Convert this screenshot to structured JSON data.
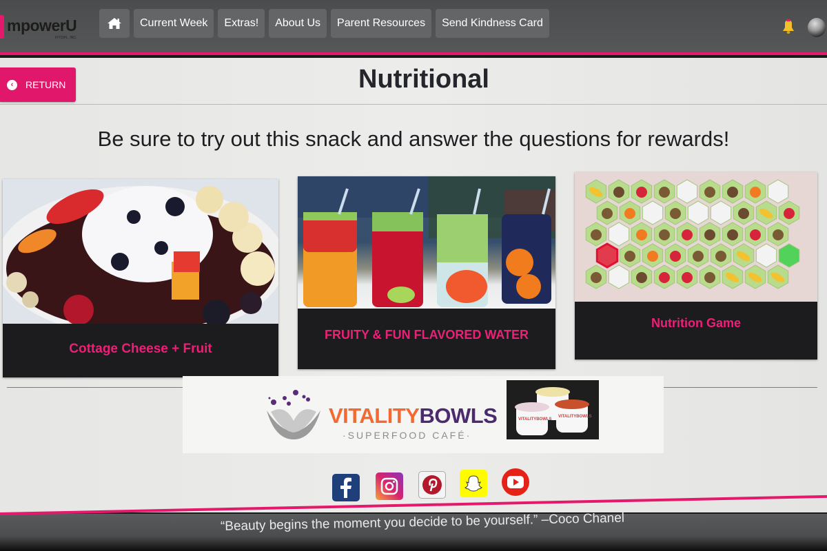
{
  "brand": {
    "logo_text": "mpowerU",
    "logo_subtext": "FITCIPL, INC."
  },
  "nav": {
    "home_icon": "home-icon",
    "items": [
      {
        "label": "Current Week"
      },
      {
        "label": "Extras!"
      },
      {
        "label": "About Us"
      },
      {
        "label": "Parent Resources"
      },
      {
        "label": "Send Kindness Card"
      }
    ]
  },
  "header_icons": {
    "notifications": "bell-icon",
    "profile": "avatar"
  },
  "page": {
    "return_label": "RETURN",
    "title": "Nutritional",
    "subtitle": "Be sure to try out this snack and answer the questions for rewards!"
  },
  "cards": [
    {
      "label": "Cottage Cheese + Fruit",
      "image": "cottage cheese with fruit, nuts and berries"
    },
    {
      "label": "FRUITY & FUN FLAVORED WATER",
      "image": "four mason jars of fruit-infused water"
    },
    {
      "label": "Nutrition Game",
      "image": "hexagon fruit-matching game board"
    }
  ],
  "ad": {
    "brand_part1": "VITALITY",
    "brand_part2": "BOWLS",
    "tagline": "·SUPERFOOD CAFÉ·",
    "cup_label": "VITALITYBOWLS"
  },
  "social": [
    {
      "name": "facebook",
      "glyph": "f",
      "color": "#1e3f7a"
    },
    {
      "name": "instagram",
      "glyph": "◎",
      "color": "#c1307a"
    },
    {
      "name": "pinterest",
      "glyph": "P",
      "color": "#b3192a"
    },
    {
      "name": "snapchat",
      "glyph": "👻",
      "color": "#fffc00"
    },
    {
      "name": "youtube",
      "glyph": "▶",
      "color": "#e62117"
    }
  ],
  "footer": {
    "quote": "“Beauty begins the moment you decide to be yourself.” –Coco Chanel"
  },
  "colors": {
    "accent": "#e5196b",
    "nav_bg": "#4f5051",
    "nav_button": "#646566",
    "card_label": "#ee1f77"
  }
}
